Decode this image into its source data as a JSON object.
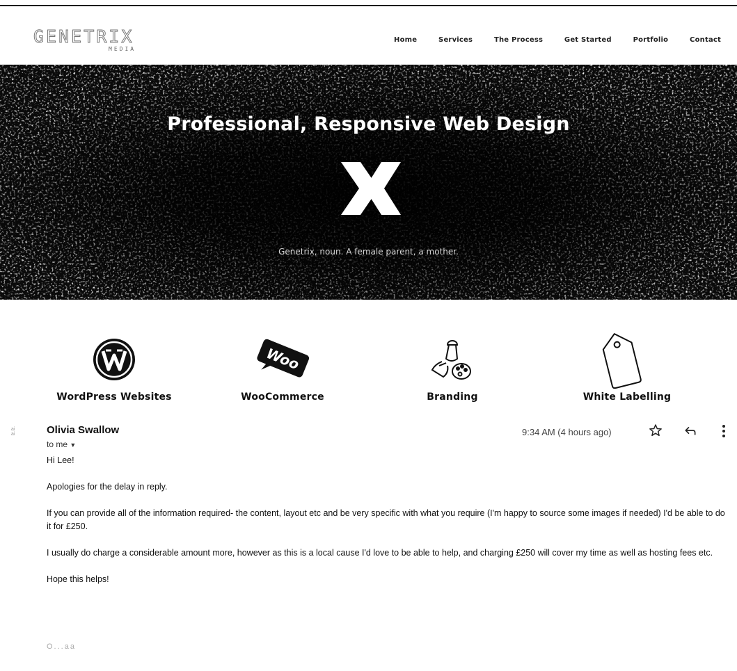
{
  "site": {
    "logo_text": "GENETRIX",
    "logo_sub": "MEDIA",
    "nav": [
      "Home",
      "Services",
      "The Process",
      "Get Started",
      "Portfolio",
      "Contact"
    ],
    "hero": {
      "title": "Professional, Responsive Web Design",
      "tagline": "Genetrix, noun. A female parent, a mother."
    },
    "services": [
      {
        "label": "WordPress Websites",
        "icon": "wordpress-icon"
      },
      {
        "label": "WooCommerce",
        "icon": "woo-icon"
      },
      {
        "label": "Branding",
        "icon": "branding-icon"
      },
      {
        "label": "White Labelling",
        "icon": "tag-icon"
      }
    ],
    "woo_badge": "Woo"
  },
  "email": {
    "sender": "Olivia Swallow",
    "recipient": "to me",
    "timestamp": "9:34 AM (4 hours ago)",
    "body": [
      "Hi Lee!",
      "Apologies for the delay in reply.",
      "If you can provide all of the information required- the content, layout etc and be very specific with what you require (I'm happy to source some images if needed) I'd be able to do it for £250.",
      "I usually do charge a considerable amount more, however as this is a local cause I'd love to be able to help, and charging £250 will cover my time as well as hosting fees etc.",
      "Hope this helps!"
    ],
    "signature": "O...aa"
  },
  "icons": {
    "star": "star-icon",
    "reply": "reply-icon",
    "more": "more-vert-icon",
    "dropdown": "chevron-down-icon"
  }
}
